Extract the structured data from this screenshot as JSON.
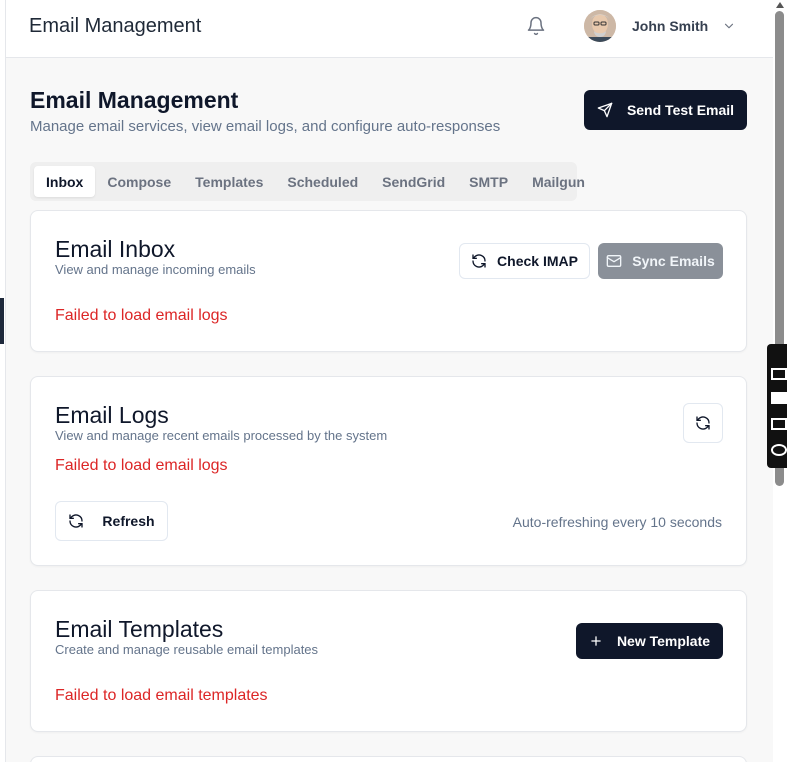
{
  "topbar": {
    "title": "Email Management",
    "user_name": "John Smith"
  },
  "header": {
    "title": "Email Management",
    "subtitle": "Manage email services, view email logs, and configure auto-responses",
    "send_test_label": "Send Test Email"
  },
  "tabs": [
    {
      "label": "Inbox",
      "active": true
    },
    {
      "label": "Compose"
    },
    {
      "label": "Templates"
    },
    {
      "label": "Scheduled"
    },
    {
      "label": "SendGrid"
    },
    {
      "label": "SMTP"
    },
    {
      "label": "Mailgun"
    }
  ],
  "inbox": {
    "title": "Email Inbox",
    "subtitle": "View and manage incoming emails",
    "check_imap_label": "Check IMAP",
    "sync_label": "Sync Emails",
    "error": "Failed to load email logs"
  },
  "logs": {
    "title": "Email Logs",
    "subtitle": "View and manage recent emails processed by the system",
    "error": "Failed to load email logs",
    "refresh_label": "Refresh",
    "auto_refresh": "Auto-refreshing every 10 seconds"
  },
  "templates": {
    "title": "Email Templates",
    "subtitle": "Create and manage reusable email templates",
    "new_label": "New Template",
    "error": "Failed to load email templates"
  },
  "colors": {
    "primary": "#0f172a",
    "error": "#dc2626",
    "muted": "#64748b",
    "disabled": "#8a9099"
  }
}
